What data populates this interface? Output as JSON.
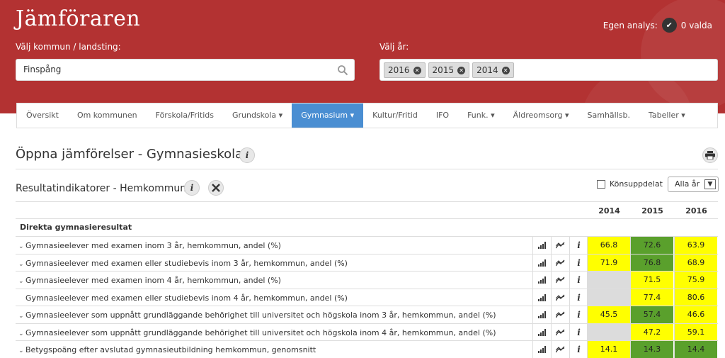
{
  "app": {
    "title": "Jämföraren"
  },
  "header": {
    "egen_label": "Egen analys:",
    "valda_label": "0 valda",
    "kommun_label": "Välj kommun / landsting:",
    "kommun_value": "Finspång",
    "year_label": "Välj år:",
    "years": [
      "2016",
      "2015",
      "2014"
    ]
  },
  "nav": {
    "items": [
      "Översikt",
      "Om kommunen",
      "Förskola/Fritids",
      "Grundskola ▾",
      "Gymnasium ▾",
      "Kultur/Fritid",
      "IFO",
      "Funk. ▾",
      "Äldreomsorg ▾",
      "Samhällsb.",
      "Tabeller ▾"
    ],
    "active_index": 4
  },
  "section": {
    "title": "Öppna jämförelser - Gymnasieskola"
  },
  "sub": {
    "title": "Resultatindikatorer - Hemkommun",
    "konsuppdelat_label": "Könsuppdelat",
    "alla_ar_label": "Alla år"
  },
  "table": {
    "columns": [
      "2014",
      "2015",
      "2016"
    ],
    "group_title": "Direkta gymnasieresultat",
    "rows": [
      {
        "expand": "⌄",
        "name": "Gymnasieelever med examen inom 3 år, hemkommun, andel (%)",
        "values": [
          "66.8",
          "72.6",
          "63.9"
        ],
        "colors": [
          "#ffff00",
          "#5aa02c",
          "#ffff00"
        ]
      },
      {
        "expand": "⌄",
        "name": "Gymnasieelever med examen eller studiebevis inom 3 år, hemkommun, andel (%)",
        "values": [
          "71.9",
          "76.8",
          "68.9"
        ],
        "colors": [
          "#ffff00",
          "#5aa02c",
          "#ffff00"
        ]
      },
      {
        "expand": "⌄",
        "name": "Gymnasieelever med examen inom 4 år, hemkommun, andel (%)",
        "values": [
          "",
          "71.5",
          "75.9"
        ],
        "colors": [
          "#dcdcdc",
          "#ffff00",
          "#ffff00"
        ]
      },
      {
        "expand": "",
        "name": "Gymnasieelever med examen eller studiebevis inom 4 år, hemkommun, andel (%)",
        "values": [
          "",
          "77.4",
          "80.6"
        ],
        "colors": [
          "#dcdcdc",
          "#ffff00",
          "#ffff00"
        ]
      },
      {
        "expand": "⌄",
        "name": "Gymnasieelever som uppnått grundläggande behörighet till universitet och högskola inom 3 år, hemkommun, andel (%)",
        "values": [
          "45.5",
          "57.4",
          "46.6"
        ],
        "colors": [
          "#ffff00",
          "#5aa02c",
          "#ffff00"
        ]
      },
      {
        "expand": "⌄",
        "name": "Gymnasieelever som uppnått grundläggande behörighet till universitet och högskola inom 4 år, hemkommun, andel (%)",
        "values": [
          "",
          "47.2",
          "59.1"
        ],
        "colors": [
          "#dcdcdc",
          "#ffff00",
          "#ffff00"
        ]
      },
      {
        "expand": "⌄",
        "name": "Betygspoäng efter avslutad gymnasieutbildning hemkommun, genomsnitt",
        "values": [
          "14.1",
          "14.3",
          "14.4"
        ],
        "colors": [
          "#ffff00",
          "#5aa02c",
          "#5aa02c"
        ]
      }
    ]
  }
}
